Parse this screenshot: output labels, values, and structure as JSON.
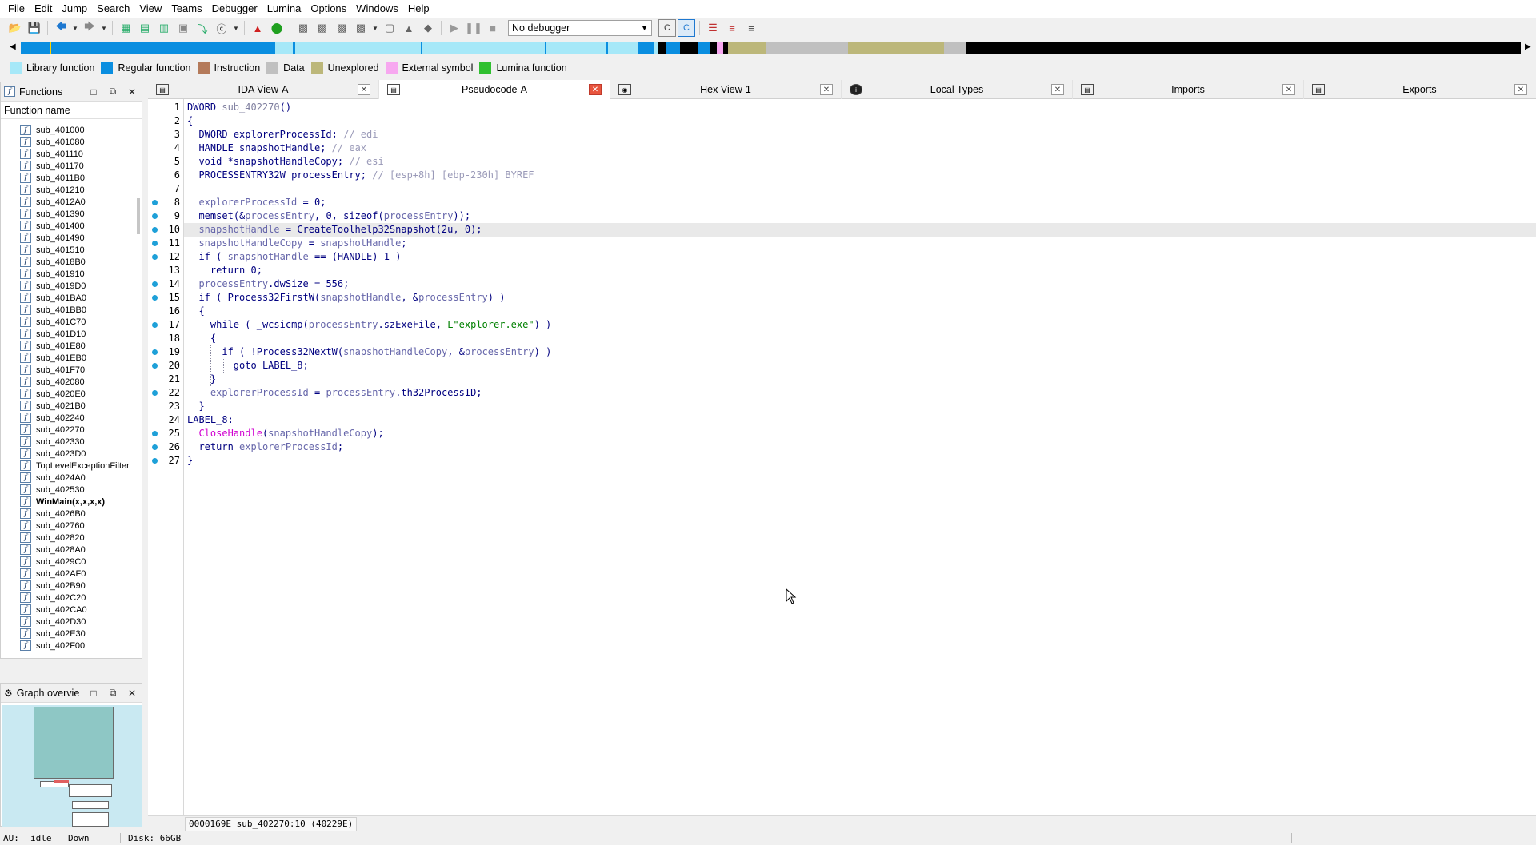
{
  "menu": [
    "File",
    "Edit",
    "Jump",
    "Search",
    "View",
    "Teams",
    "Debugger",
    "Lumina",
    "Options",
    "Windows",
    "Help"
  ],
  "toolbar": {
    "debugger_select": "No debugger"
  },
  "legend": [
    {
      "label": "Library function",
      "color": "#a6e8f8"
    },
    {
      "label": "Regular function",
      "color": "#0a8ee0"
    },
    {
      "label": "Instruction",
      "color": "#b47a5a"
    },
    {
      "label": "Data",
      "color": "#c0c0c0"
    },
    {
      "label": "Unexplored",
      "color": "#bcb77a"
    },
    {
      "label": "External symbol",
      "color": "#f7a8f0"
    },
    {
      "label": "Lumina function",
      "color": "#30c030"
    }
  ],
  "functions_panel": {
    "title": "Functions",
    "column": "Function name",
    "items": [
      "sub_401000",
      "sub_401080",
      "sub_401110",
      "sub_401170",
      "sub_4011B0",
      "sub_401210",
      "sub_4012A0",
      "sub_401390",
      "sub_401400",
      "sub_401490",
      "sub_401510",
      "sub_4018B0",
      "sub_401910",
      "sub_4019D0",
      "sub_401BA0",
      "sub_401BB0",
      "sub_401C70",
      "sub_401D10",
      "sub_401E80",
      "sub_401EB0",
      "sub_401F70",
      "sub_402080",
      "sub_4020E0",
      "sub_4021B0",
      "sub_402240",
      "sub_402270",
      "sub_402330",
      "sub_4023D0",
      "TopLevelExceptionFilter",
      "sub_4024A0",
      "sub_402530",
      "WinMain(x,x,x,x)",
      "sub_4026B0",
      "sub_402760",
      "sub_402820",
      "sub_4028A0",
      "sub_4029C0",
      "sub_402AF0",
      "sub_402B90",
      "sub_402C20",
      "sub_402CA0",
      "sub_402D30",
      "sub_402E30",
      "sub_402F00"
    ]
  },
  "graph_panel": {
    "title": "Graph overvie"
  },
  "tabs": [
    {
      "label": "IDA View-A"
    },
    {
      "label": "Pseudocode-A"
    },
    {
      "label": "Hex View-1"
    },
    {
      "label": "Local Types"
    },
    {
      "label": "Imports"
    },
    {
      "label": "Exports"
    }
  ],
  "code": {
    "lines": [
      "DWORD sub_402270()",
      "{",
      "  DWORD explorerProcessId; // edi",
      "  HANDLE snapshotHandle; // eax",
      "  void *snapshotHandleCopy; // esi",
      "  PROCESSENTRY32W processEntry; // [esp+8h] [ebp-230h] BYREF",
      "",
      "  explorerProcessId = 0;",
      "  memset(&processEntry, 0, sizeof(processEntry));",
      "  snapshotHandle = CreateToolhelp32Snapshot(2u, 0);",
      "  snapshotHandleCopy = snapshotHandle;",
      "  if ( snapshotHandle == (HANDLE)-1 )",
      "    return 0;",
      "  processEntry.dwSize = 556;",
      "  if ( Process32FirstW(snapshotHandle, &processEntry) )",
      "  {",
      "    while ( _wcsicmp(processEntry.szExeFile, L\"explorer.exe\") )",
      "    {",
      "      if ( !Process32NextW(snapshotHandleCopy, &processEntry) )",
      "        goto LABEL_8;",
      "    }",
      "    explorerProcessId = processEntry.th32ProcessID;",
      "  }",
      "LABEL_8:",
      "  CloseHandle(snapshotHandleCopy);",
      "  return explorerProcessId;",
      "}"
    ]
  },
  "code_status": "0000169E sub_402270:10 (40229E)",
  "statusbar": {
    "au_label": "AU:",
    "au_state": "idle",
    "direction": "Down",
    "disk": "Disk: 66GB"
  }
}
